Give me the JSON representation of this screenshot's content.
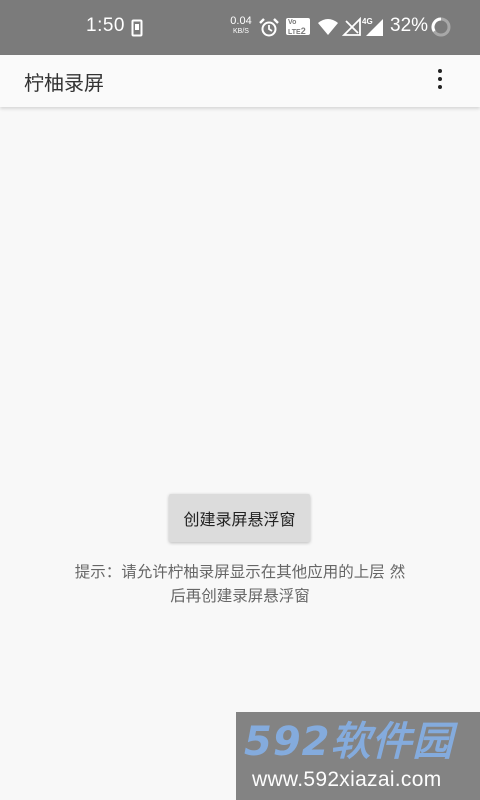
{
  "status_bar": {
    "time": "1:50",
    "net_speed_value": "0.04",
    "net_speed_unit": "KB/S",
    "volte_label_line1": "Vo",
    "volte_label_line2": "LTE",
    "volte_sim": "2",
    "network_type": "4G",
    "battery_percent": "32%"
  },
  "app_bar": {
    "title": "柠柚录屏"
  },
  "main": {
    "create_button_label": "创建录屏悬浮窗",
    "hint_line1": "提示：请允许柠柚录屏显示在其他应用的上层 然",
    "hint_line2": "后再创建录屏悬浮窗"
  },
  "watermark": {
    "logo_text": "592软件园",
    "url": "www.592xiazai.com"
  },
  "colors": {
    "status_bar_bg": "#7b7b7b",
    "app_bar_bg": "#fafafa",
    "screen_bg": "#f8f8f8",
    "button_bg": "#dcdcdc",
    "watermark_logo": "#6b9bd8"
  }
}
